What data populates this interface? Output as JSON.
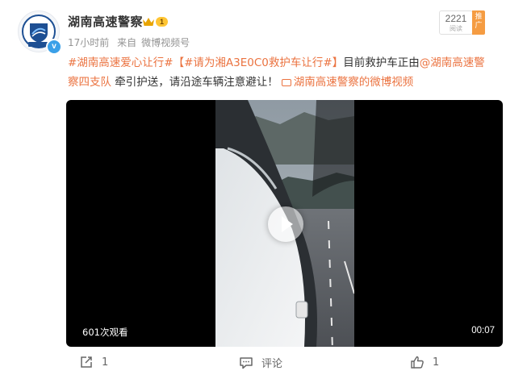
{
  "post": {
    "author": "湖南高速警察",
    "level": "1",
    "time": "17小时前",
    "source_prefix": "来自",
    "source": "微博视频号",
    "reads": "2221",
    "reads_label": "阅读",
    "promo": "推广"
  },
  "content": {
    "tag1": "#湖南高速爱心让行#",
    "tag2": "【#请为湘A3E0C0救护车让行#】",
    "text1": "目前救护车正由",
    "mention": "@湖南高速警察四支队",
    "text2": " 牵引护送，请沿途车辆注意避让！",
    "video_link": "湖南高速警察的微博视频"
  },
  "video": {
    "views": "601次观看",
    "duration": "00:07"
  },
  "actions": {
    "repost_count": "1",
    "comment_label": "评论",
    "like_count": "1"
  },
  "colors": {
    "accent": "#eb7340",
    "verified": "#3aa0e8"
  },
  "icons": {
    "avatar": "police-badge-avatar",
    "level": "crown-icon",
    "repost": "repost-icon",
    "comment": "comment-icon",
    "like": "thumbs-up-icon",
    "video_link": "video-link-icon",
    "play": "play-icon"
  }
}
